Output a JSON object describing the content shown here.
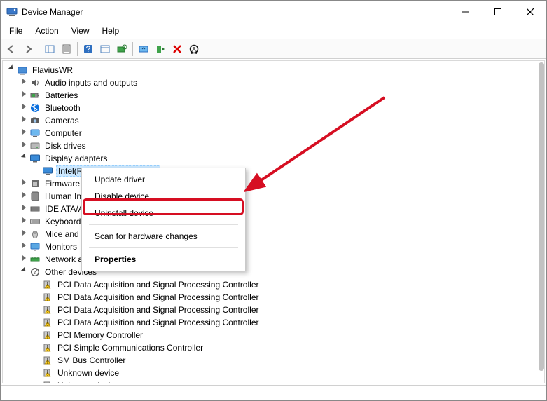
{
  "window": {
    "title": "Device Manager"
  },
  "menubar": {
    "items": [
      "File",
      "Action",
      "View",
      "Help"
    ]
  },
  "toolbar_icons": [
    "back",
    "forward",
    "sep",
    "show-hide",
    "properties",
    "sep",
    "help",
    "action-center",
    "scan",
    "sep",
    "monitor",
    "update",
    "uninstall",
    "enable"
  ],
  "tree": {
    "root": {
      "label": "FlaviusWR",
      "expanded": true
    },
    "categories": [
      {
        "label": "Audio inputs and outputs",
        "icon": "audio",
        "expanded": false
      },
      {
        "label": "Batteries",
        "icon": "battery",
        "expanded": false
      },
      {
        "label": "Bluetooth",
        "icon": "bluetooth",
        "expanded": false
      },
      {
        "label": "Cameras",
        "icon": "camera",
        "expanded": false
      },
      {
        "label": "Computer",
        "icon": "computer",
        "expanded": false
      },
      {
        "label": "Disk drives",
        "icon": "disk",
        "expanded": false
      },
      {
        "label": "Display adapters",
        "icon": "display",
        "expanded": true,
        "children": [
          {
            "label": "Intel(R) UHD Graphics 620",
            "icon": "display",
            "selected": true
          }
        ]
      },
      {
        "label": "Firmware",
        "icon": "firmware",
        "expanded": false
      },
      {
        "label": "Human Interface Devices",
        "icon": "hid",
        "expanded": false
      },
      {
        "label": "IDE ATA/ATAPI controllers",
        "icon": "ide",
        "expanded": false
      },
      {
        "label": "Keyboards",
        "icon": "keyboard",
        "expanded": false
      },
      {
        "label": "Mice and other pointing devices",
        "icon": "mouse",
        "expanded": false
      },
      {
        "label": "Monitors",
        "icon": "monitor",
        "expanded": false
      },
      {
        "label": "Network adapters",
        "icon": "network",
        "expanded": false
      },
      {
        "label": "Other devices",
        "icon": "other",
        "expanded": true,
        "children": [
          {
            "label": "PCI Data Acquisition and Signal Processing Controller",
            "icon": "warn"
          },
          {
            "label": "PCI Data Acquisition and Signal Processing Controller",
            "icon": "warn"
          },
          {
            "label": "PCI Data Acquisition and Signal Processing Controller",
            "icon": "warn"
          },
          {
            "label": "PCI Data Acquisition and Signal Processing Controller",
            "icon": "warn"
          },
          {
            "label": "PCI Memory Controller",
            "icon": "warn"
          },
          {
            "label": "PCI Simple Communications Controller",
            "icon": "warn"
          },
          {
            "label": "SM Bus Controller",
            "icon": "warn"
          },
          {
            "label": "Unknown device",
            "icon": "warn"
          },
          {
            "label": "Unknown device",
            "icon": "warn"
          }
        ]
      }
    ]
  },
  "context_menu": {
    "items": [
      {
        "label": "Update driver",
        "type": "item"
      },
      {
        "label": "Disable device",
        "type": "item"
      },
      {
        "label": "Uninstall device",
        "type": "item",
        "highlighted": true
      },
      {
        "type": "sep"
      },
      {
        "label": "Scan for hardware changes",
        "type": "item"
      },
      {
        "type": "sep"
      },
      {
        "label": "Properties",
        "type": "item",
        "bold": true
      }
    ]
  },
  "statusbar": {
    "cells": [
      "",
      ""
    ]
  }
}
